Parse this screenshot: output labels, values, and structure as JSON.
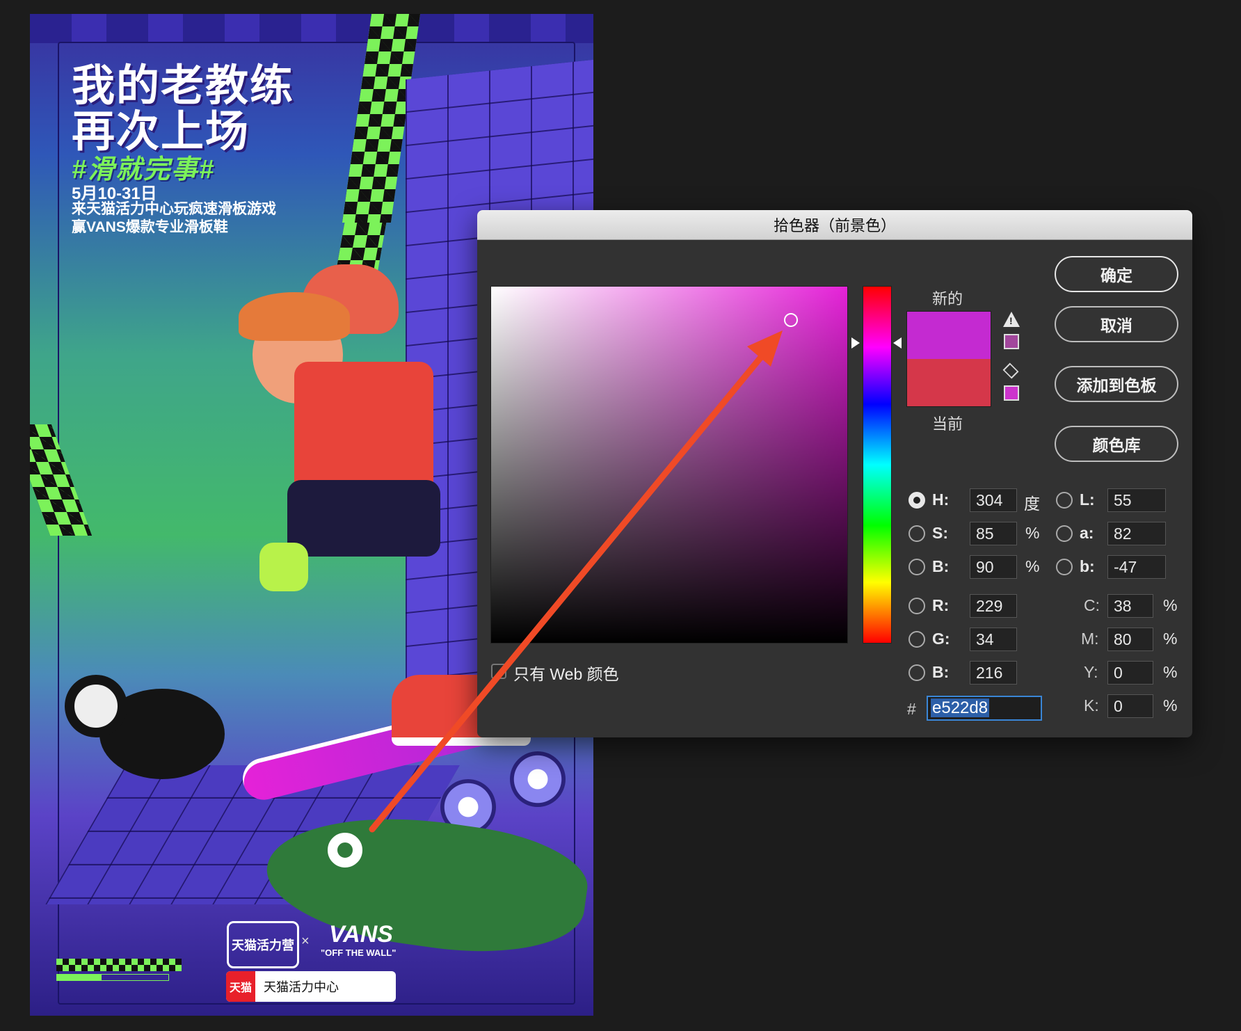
{
  "poster": {
    "title_line1": "我的老教练",
    "title_line2": "再次上场",
    "hashtag": "#滑就完事#",
    "date": "5月10-31日",
    "desc_line1": "来天猫活力中心玩疯速滑板游戏",
    "desc_line2": "赢VANS爆款专业滑板鞋",
    "logo_tmall": "天猫活力营",
    "logo_x": "×",
    "logo_vans": "VANS",
    "logo_vans_sub": "\"OFF THE WALL\"",
    "search_brand": "天猫",
    "search_text": "天猫活力中心"
  },
  "dialog": {
    "title": "拾色器（前景色）",
    "new_label": "新的",
    "current_label": "当前",
    "buttons": {
      "ok": "确定",
      "cancel": "取消",
      "add_swatch": "添加到色板",
      "color_library": "颜色库"
    },
    "web_only_label": "只有 Web 颜色",
    "fields": {
      "H": {
        "label": "H:",
        "value": "304",
        "unit": "度"
      },
      "S": {
        "label": "S:",
        "value": "85",
        "unit": "%"
      },
      "B_hsb": {
        "label": "B:",
        "value": "90",
        "unit": "%"
      },
      "R": {
        "label": "R:",
        "value": "229"
      },
      "G": {
        "label": "G:",
        "value": "34"
      },
      "B_rgb": {
        "label": "B:",
        "value": "216"
      },
      "L": {
        "label": "L:",
        "value": "55"
      },
      "a": {
        "label": "a:",
        "value": "82"
      },
      "b": {
        "label": "b:",
        "value": "-47"
      },
      "C": {
        "label": "C:",
        "value": "38",
        "unit": "%"
      },
      "M": {
        "label": "M:",
        "value": "80",
        "unit": "%"
      },
      "Y": {
        "label": "Y:",
        "value": "0",
        "unit": "%"
      },
      "K": {
        "label": "K:",
        "value": "0",
        "unit": "%"
      }
    },
    "hex_label": "#",
    "hex_value": "e522d8",
    "colors": {
      "new": "#c42ad1",
      "current": "#d5374a",
      "picked": "#e522d8",
      "annotation_arrow": "#f04a26"
    }
  }
}
